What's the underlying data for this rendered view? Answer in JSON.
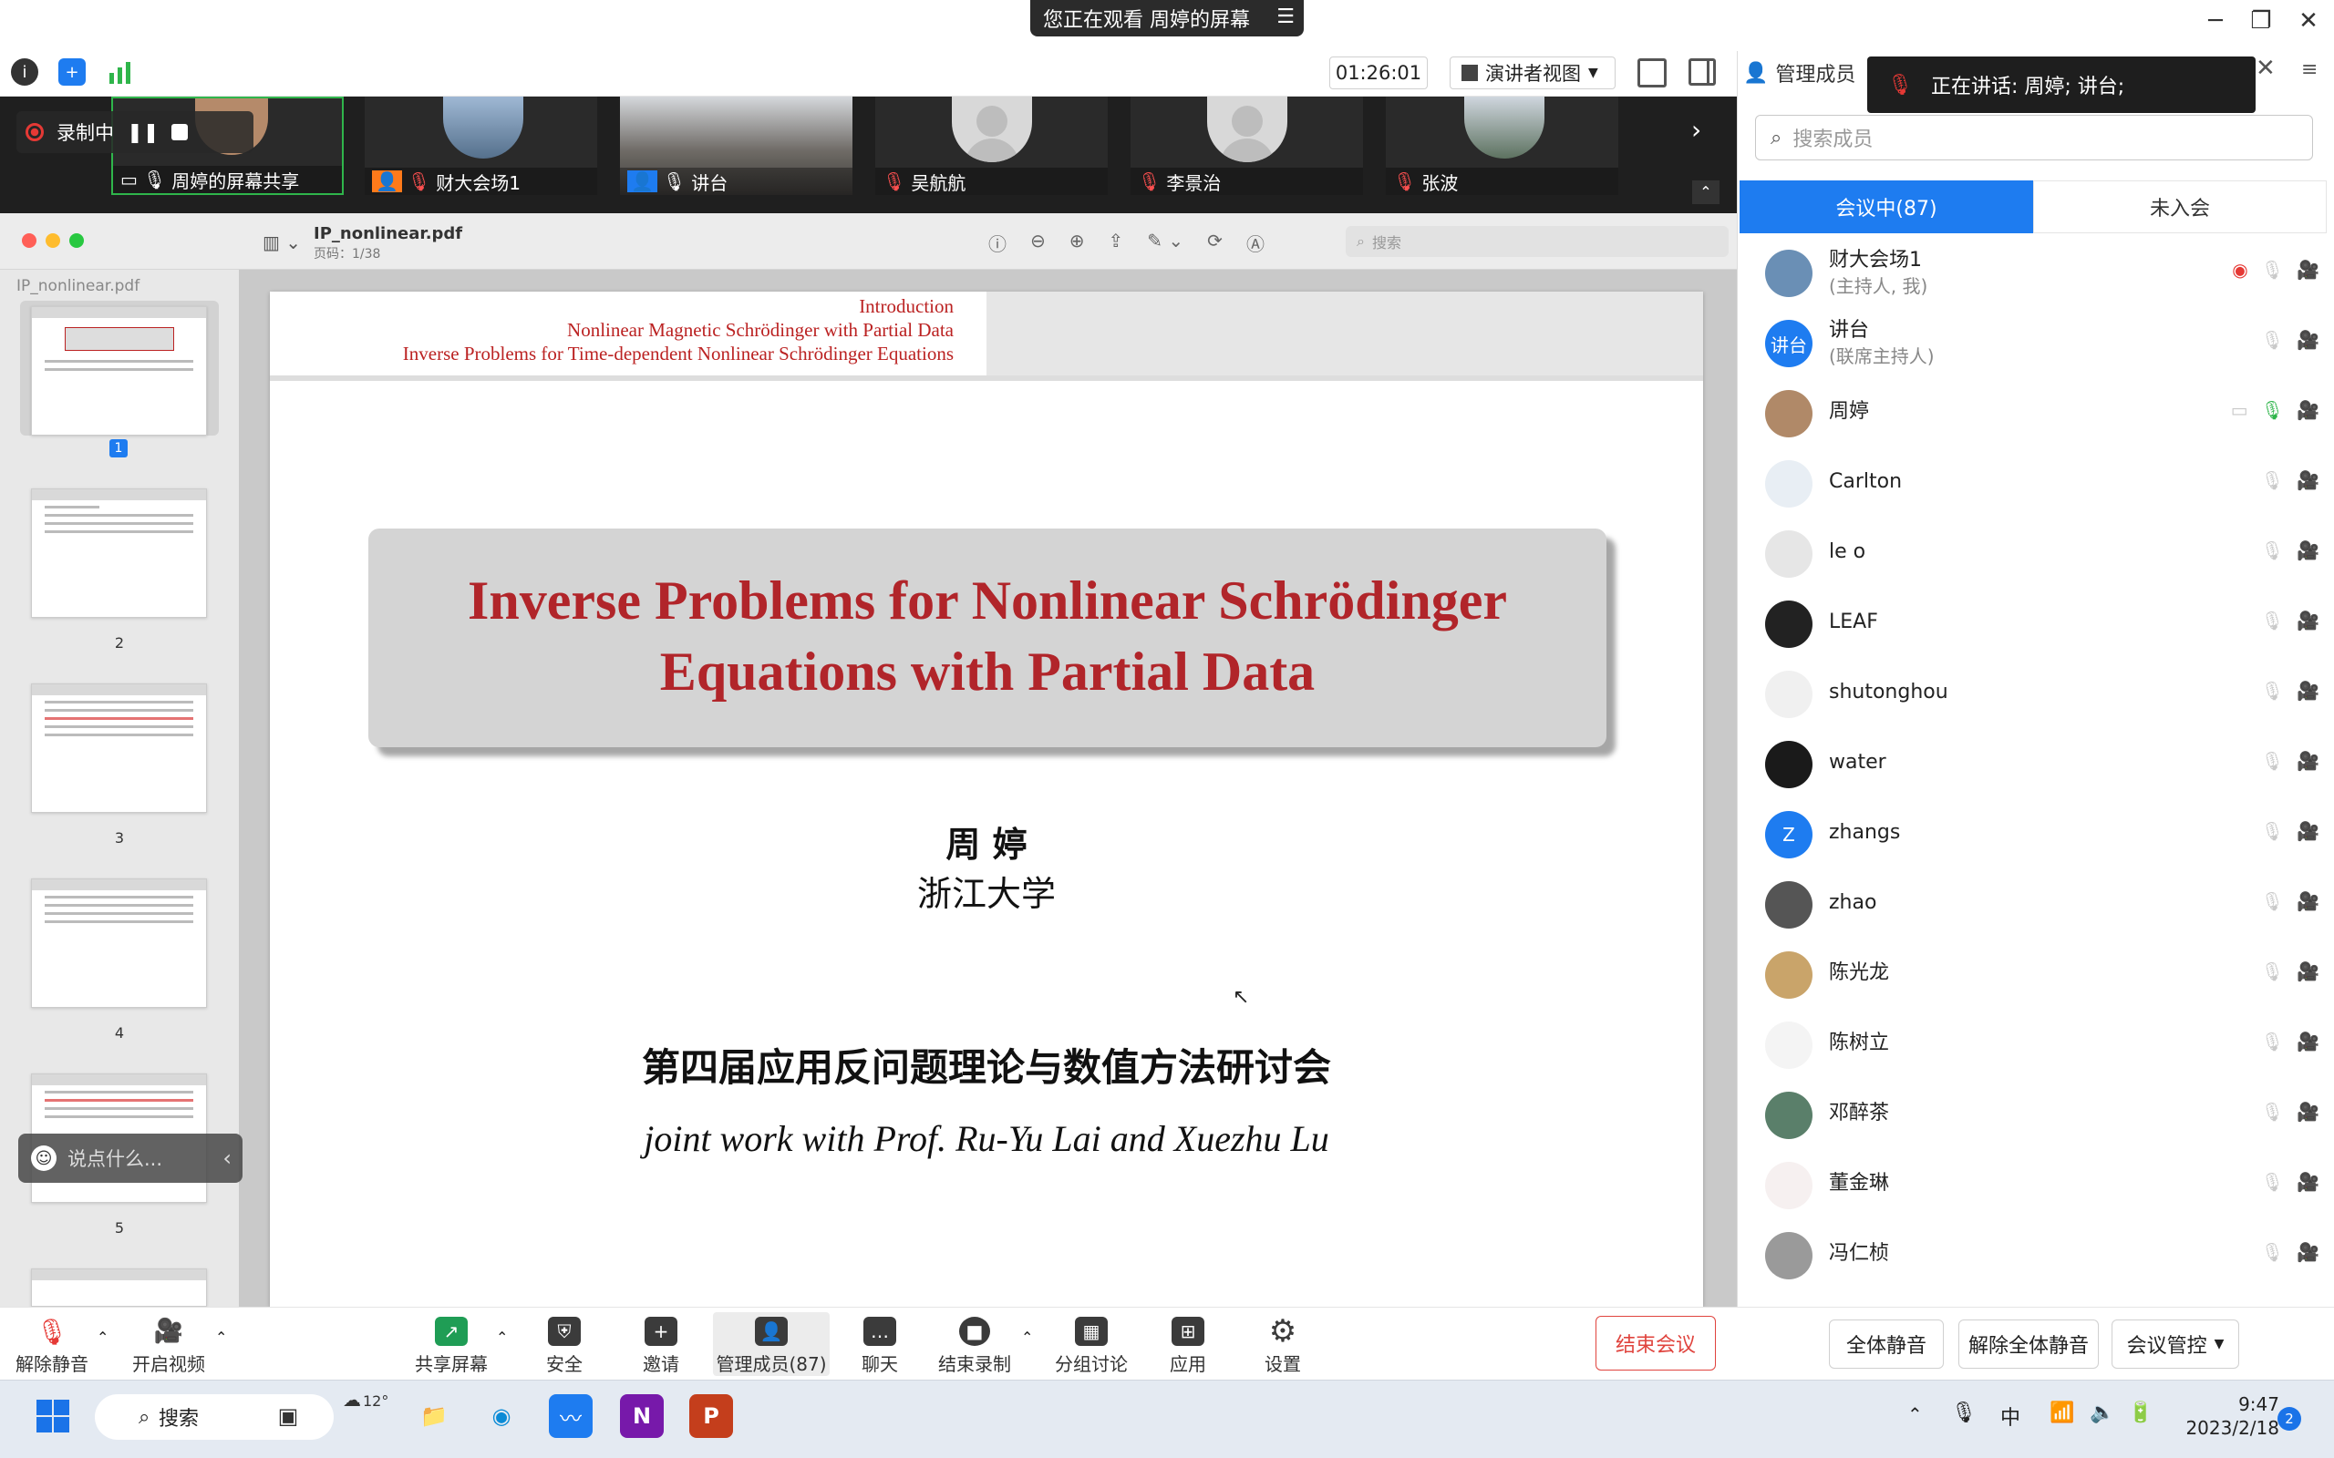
{
  "banner": {
    "text": "您正在观看  周婷的屏幕",
    "menu_icon": "☰"
  },
  "window_controls": {
    "minimize": "─",
    "restore": "❐",
    "close": "✕"
  },
  "meeting_toolbar": {
    "timer": "01:26:01",
    "view_label": "演讲者视图"
  },
  "recording": {
    "label": "录制中"
  },
  "video_tiles": [
    {
      "name": "周婷的屏幕共享"
    },
    {
      "name": "财大会场1"
    },
    {
      "name": "讲台"
    },
    {
      "name": "吴航航"
    },
    {
      "name": "李景治"
    },
    {
      "name": "张波"
    }
  ],
  "pdf": {
    "filename": "IP_nonlinear.pdf",
    "page_info": "页码：1/38",
    "sidebar_title": "IP_nonlinear.pdf",
    "search_placeholder": "搜索",
    "thumbnails": [
      "1",
      "2",
      "3",
      "4",
      "5"
    ],
    "slide": {
      "nav": [
        "Introduction",
        "Nonlinear Magnetic Schrödinger with Partial Data",
        "Inverse Problems for Time-dependent Nonlinear Schrödinger Equations"
      ],
      "title_line1": "Inverse Problems for Nonlinear Schrödinger",
      "title_line2": "Equations with Partial Data",
      "author": "周 婷",
      "affiliation": "浙江大学",
      "conference": "第四届应用反问题理论与数值方法研讨会",
      "joint": "joint work with Prof. Ru-Yu Lai and Xuezhu Lu"
    }
  },
  "chat": {
    "placeholder": "说点什么..."
  },
  "bottom_bar": {
    "unmute": "解除静音",
    "video": "开启视频",
    "share": "共享屏幕",
    "security": "安全",
    "invite": "邀请",
    "members": "管理成员(87)",
    "chat": "聊天",
    "end_record": "结束录制",
    "breakout": "分组讨论",
    "apps": "应用",
    "settings": "设置",
    "end_meeting": "结束会议"
  },
  "panel": {
    "title": "管理成员",
    "speaking": "正在讲话:  周婷; 讲台;",
    "search_placeholder": "搜索成员",
    "tab_in": "会议中(87)",
    "tab_out": "未入会",
    "members": [
      {
        "name": "财大会场1",
        "sub": "(主持人, 我)",
        "avatar_color": "#6a8fb5"
      },
      {
        "name": "讲台",
        "sub": "(联席主持人)",
        "avatar_color": "#1e7cf0",
        "avatar_text": "讲台"
      },
      {
        "name": "周婷",
        "sub": "",
        "avatar_color": "#b08968"
      },
      {
        "name": "Carlton",
        "sub": "",
        "avatar_color": "#e8eef4"
      },
      {
        "name": "le o",
        "sub": "",
        "avatar_color": "#e6e6e6"
      },
      {
        "name": "LEAF",
        "sub": "",
        "avatar_color": "#222222"
      },
      {
        "name": "shutonghou",
        "sub": "",
        "avatar_color": "#f0f0f0"
      },
      {
        "name": "water",
        "sub": "",
        "avatar_color": "#1a1a1a"
      },
      {
        "name": "zhangs",
        "sub": "",
        "avatar_color": "#1e7cf0",
        "avatar_text": "Z"
      },
      {
        "name": "zhao",
        "sub": "",
        "avatar_color": "#555555"
      },
      {
        "name": "陈光龙",
        "sub": "",
        "avatar_color": "#c9a46a"
      },
      {
        "name": "陈树立",
        "sub": "",
        "avatar_color": "#f4f4f4"
      },
      {
        "name": "邓醉茶",
        "sub": "",
        "avatar_color": "#5a7f6a"
      },
      {
        "name": "董金琳",
        "sub": "",
        "avatar_color": "#f6f0f0"
      },
      {
        "name": "冯仁桢",
        "sub": "",
        "avatar_color": "#9a9a9a"
      }
    ],
    "mute_all": "全体静音",
    "unmute_all": "解除全体静音",
    "control": "会议管控"
  },
  "taskbar": {
    "search": "搜索",
    "weather": "12°",
    "ime": "中",
    "time": "9:47",
    "date": "2023/2/18",
    "notifications": "2"
  }
}
